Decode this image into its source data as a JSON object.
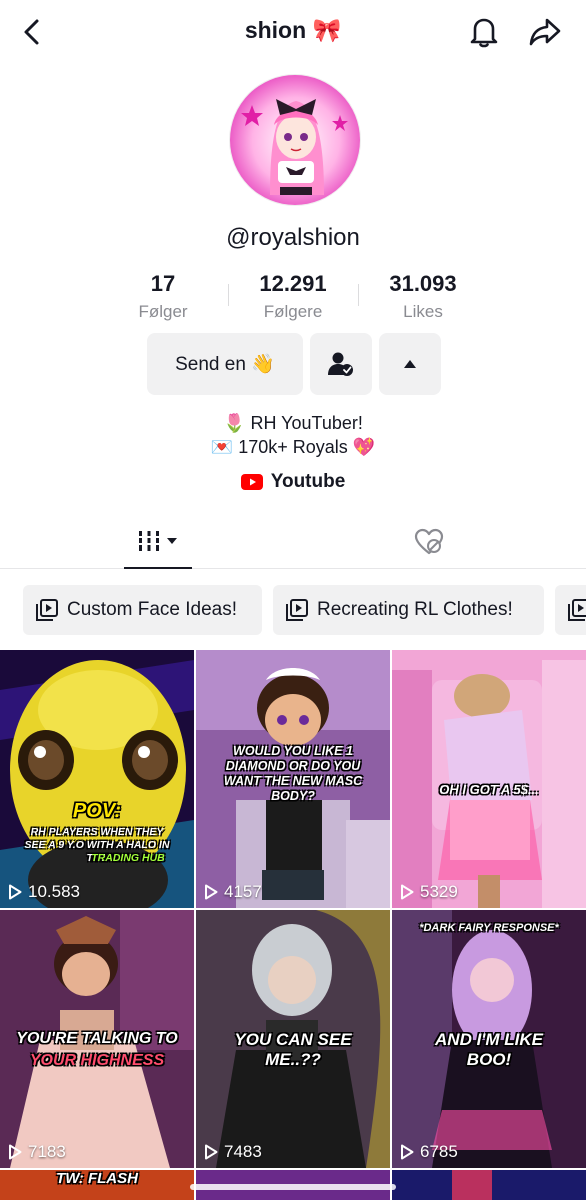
{
  "header": {
    "title": "shion 🎀",
    "back_icon": "chevron-left-icon",
    "bell_icon": "bell-icon",
    "share_icon": "share-arrow-icon"
  },
  "profile": {
    "handle": "@royalshion"
  },
  "stats": [
    {
      "value": "17",
      "label": "Følger"
    },
    {
      "value": "12.291",
      "label": "Følgere"
    },
    {
      "value": "31.093",
      "label": "Likes"
    }
  ],
  "actions": {
    "message_label": "Send en 👋"
  },
  "bio": {
    "line1": "🌷 RH YouTuber!",
    "line2": "💌 170k+ Royals 💖",
    "link_label": "Youtube"
  },
  "playlists": [
    {
      "label": "Custom Face Ideas!"
    },
    {
      "label": "Recreating RL Clothes!"
    }
  ],
  "videos": [
    {
      "caption": "POV:",
      "caption2": "RH PLAYERS WHEN THEY SEE A 9 Y.O WITH A HALO IN THE",
      "caption3": "TRADING HUB",
      "views": "10.583"
    },
    {
      "caption": "WOULD YOU LIKE 1 DIAMOND OR DO YOU WANT THE NEW MASC BODY?",
      "views": "4157"
    },
    {
      "caption": "OH I GOT A 5$...",
      "views": "5329"
    },
    {
      "caption": "YOU'RE TALKING TO",
      "caption2": "YOUR HIGHNESS",
      "views": "7183"
    },
    {
      "caption": "YOU CAN SEE ME..??",
      "views": "7483"
    },
    {
      "caption": "*DARK FAIRY RESPONSE*",
      "caption2": "AND I'M LIKE BOO!",
      "views": "6785"
    },
    {
      "caption": "TW: FLASH"
    }
  ],
  "colors": {
    "accent_red": "#fe2c55",
    "youtube_red": "#ff0000",
    "chip_bg": "#f1f1f2"
  }
}
